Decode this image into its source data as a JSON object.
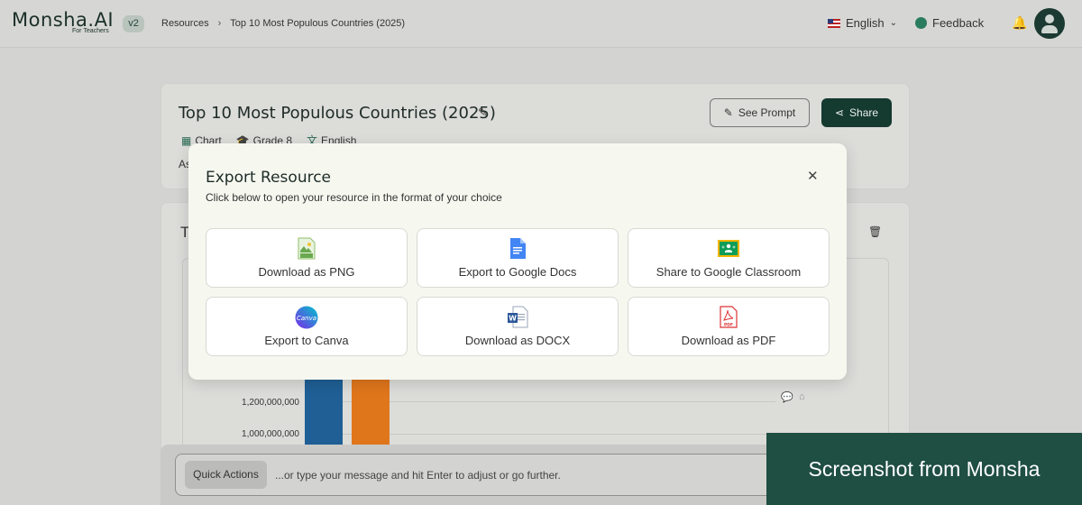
{
  "topbar": {
    "logo": "Monsha.AI",
    "logo_sub": "For Teachers",
    "version": "v2",
    "breadcrumb": [
      "Resources",
      "Top 10 Most Populous Countries (2025)"
    ],
    "language": "English",
    "feedback": "Feedback"
  },
  "resource": {
    "title": "Top 10 Most Populous Countries (2025)",
    "meta": [
      "Chart",
      "Grade 8",
      "English"
    ],
    "desc_start": "As",
    "see_prompt": "See Prompt",
    "share": "Share"
  },
  "chart_card": {
    "title_start": "T",
    "y_ticks": [
      "1,200,000,000",
      "1,000,000,000"
    ]
  },
  "chart_data": {
    "type": "bar",
    "y_tick_labels": [
      "1,200,000,000",
      "1,000,000,000"
    ],
    "series_colors": [
      "#1f5f95",
      "#e0761c"
    ]
  },
  "bottom": {
    "quick_actions": "Quick Actions",
    "placeholder": "...or type your message and hit Enter to adjust or go further."
  },
  "modal": {
    "title": "Export Resource",
    "subtitle": "Click below to open your resource in the format of your choice",
    "options": [
      {
        "label": "Download as PNG",
        "icon": "png-icon"
      },
      {
        "label": "Export to Google Docs",
        "icon": "google-docs-icon"
      },
      {
        "label": "Share to Google Classroom",
        "icon": "google-classroom-icon"
      },
      {
        "label": "Export to Canva",
        "icon": "canva-icon"
      },
      {
        "label": "Download as DOCX",
        "icon": "docx-icon"
      },
      {
        "label": "Download as PDF",
        "icon": "pdf-icon"
      }
    ]
  },
  "brand": "Screenshot from Monsha"
}
